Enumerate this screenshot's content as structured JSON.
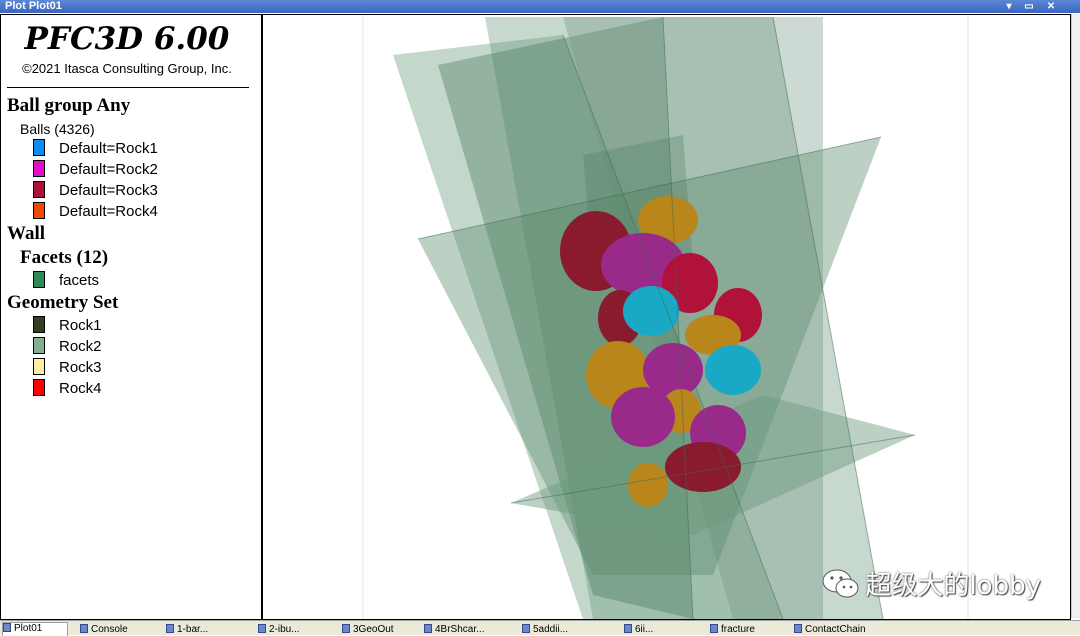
{
  "window": {
    "title": "Plot Plot01",
    "controls": [
      "▾",
      "▭",
      "✕"
    ]
  },
  "legend": {
    "app_title": "PFC3D 6.00",
    "copyright": "©2021 Itasca Consulting Group, Inc.",
    "ball_heading": "Ball group Any",
    "balls_label": "Balls (4326)",
    "ball_groups": [
      {
        "label": "Default=Rock1",
        "color": "#0a8ff0"
      },
      {
        "label": "Default=Rock2",
        "color": "#e010c8"
      },
      {
        "label": "Default=Rock3",
        "color": "#b01038"
      },
      {
        "label": "Default=Rock4",
        "color": "#f04a00"
      }
    ],
    "wall_heading": "Wall",
    "facets_label": "Facets (12)",
    "facet_items": [
      {
        "label": "facets",
        "color": "#2e8b57"
      }
    ],
    "geometry_heading": "Geometry Set",
    "geometry_items": [
      {
        "label": "Rock1",
        "color": "#2f3f20"
      },
      {
        "label": "Rock2",
        "color": "#7fb08f"
      },
      {
        "label": "Rock3",
        "color": "#fff0a0"
      },
      {
        "label": "Rock4",
        "color": "#ff0000"
      }
    ]
  },
  "tabs": [
    {
      "label": "Plot01",
      "active": true
    },
    {
      "label": "Console"
    },
    {
      "label": "1-bar..."
    },
    {
      "label": "2-ibu..."
    },
    {
      "label": "3GeoOut"
    },
    {
      "label": "4BrShcar..."
    },
    {
      "label": "5addii..."
    },
    {
      "label": "6ii..."
    },
    {
      "label": "fracture"
    },
    {
      "label": "ContactChain"
    }
  ],
  "watermark": {
    "text": "超级大的lobby",
    "icon": "wechat-icon"
  },
  "colors": {
    "wall_green": "#4f7f62",
    "particle_colors": [
      "#9a2a8a",
      "#b0123a",
      "#1aa9c4",
      "#b8861a",
      "#8a1a2e"
    ]
  }
}
